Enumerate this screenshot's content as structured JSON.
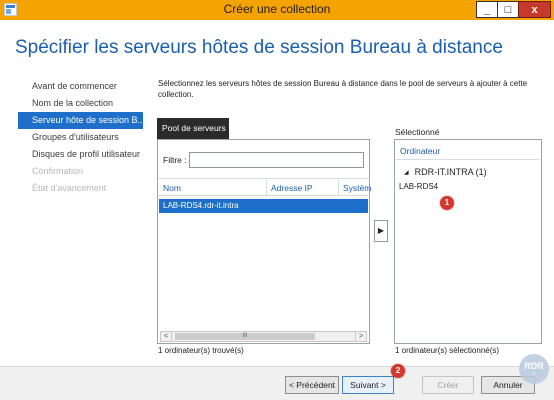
{
  "window": {
    "title": "Créer une collection",
    "minimize": "_",
    "maximize": "□",
    "close": "x"
  },
  "page_title": "Spécifier les serveurs hôtes de session Bureau à distance",
  "nav": {
    "items": [
      {
        "label": "Avant de commencer",
        "state": "normal"
      },
      {
        "label": "Nom de la collection",
        "state": "normal"
      },
      {
        "label": "Serveur hôte de session B...",
        "state": "active"
      },
      {
        "label": "Groupes d'utilisateurs",
        "state": "normal"
      },
      {
        "label": "Disques de profil utilisateur",
        "state": "normal"
      },
      {
        "label": "Confirmation",
        "state": "disabled"
      },
      {
        "label": "État d'avancement",
        "state": "disabled"
      }
    ]
  },
  "description": "Sélectionnez les serveurs hôtes de session Bureau à distance dans le pool de serveurs à ajouter à cette collection.",
  "pool": {
    "tab": "Pool de serveurs",
    "filter_label": "Filtre :",
    "filter_value": "",
    "columns": [
      "Nom",
      "Adresse IP",
      "Systèm"
    ],
    "rows": [
      "LAB-RDS4.rdr-it.intra"
    ],
    "scroll_left": "<",
    "scroll_right": ">",
    "scroll_thumb": "III",
    "count": "1 ordinateur(s) trouvé(s)"
  },
  "add_button": "▶",
  "selected": {
    "label": "Sélectionné",
    "header": "Ordinateur",
    "group_arrow": "◢",
    "group": "RDR-IT.INTRA (1)",
    "items": [
      "LAB-RDS4"
    ],
    "count": "1 ordinateur(s) sélectionné(s)"
  },
  "markers": [
    "1",
    "2"
  ],
  "footer": {
    "prev": "< Précédent",
    "next": "Suivant >",
    "create": "Créer",
    "cancel": "Annuler"
  },
  "logo": {
    "text": "RDR",
    "sub": "it"
  },
  "colors": {
    "titlebar": "#f5a300",
    "accent": "#1e6fc9",
    "heading": "#1b5fae",
    "marker": "#d8362c"
  }
}
